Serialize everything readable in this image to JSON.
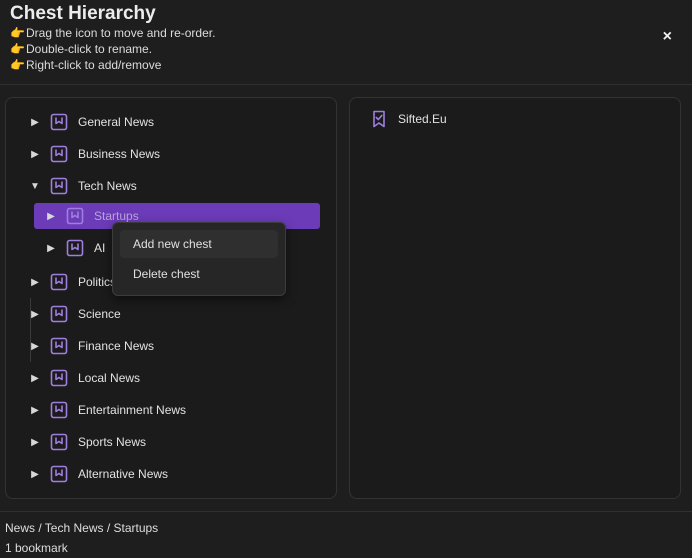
{
  "header": {
    "title": "Chest Hierarchy",
    "help": [
      "Drag the icon to move and re-order.",
      "Double-click to rename.",
      "Right-click to add/remove"
    ],
    "hand_glyph": "👉",
    "close_glyph": "×"
  },
  "tree": {
    "items": [
      {
        "label": "General News",
        "caret": "▶"
      },
      {
        "label": "Business News",
        "caret": "▶"
      },
      {
        "label": "Tech News",
        "caret": "▼",
        "expanded": true
      },
      {
        "label": "Startups",
        "caret": "▶",
        "selected": true
      },
      {
        "label": "AI",
        "caret": "▶"
      },
      {
        "label": "Politics",
        "caret": "▶"
      },
      {
        "label": "Science",
        "caret": "▶"
      },
      {
        "label": "Finance News",
        "caret": "▶"
      },
      {
        "label": "Local News",
        "caret": "▶"
      },
      {
        "label": "Entertainment News",
        "caret": "▶"
      },
      {
        "label": "Sports News",
        "caret": "▶"
      },
      {
        "label": "Alternative News",
        "caret": "▶"
      }
    ]
  },
  "context_menu": {
    "items": [
      "Add new chest",
      "Delete chest"
    ]
  },
  "bookmarks": {
    "items": [
      {
        "label": "Sifted.Eu",
        "icon": "bookmark-check-icon"
      }
    ]
  },
  "footer": {
    "breadcrumb": "News / Tech News / Startups",
    "count": "1 bookmark"
  },
  "colors": {
    "accent": "#6c3bb8",
    "icon": "#a07ee0",
    "background": "#1e1e1e"
  }
}
